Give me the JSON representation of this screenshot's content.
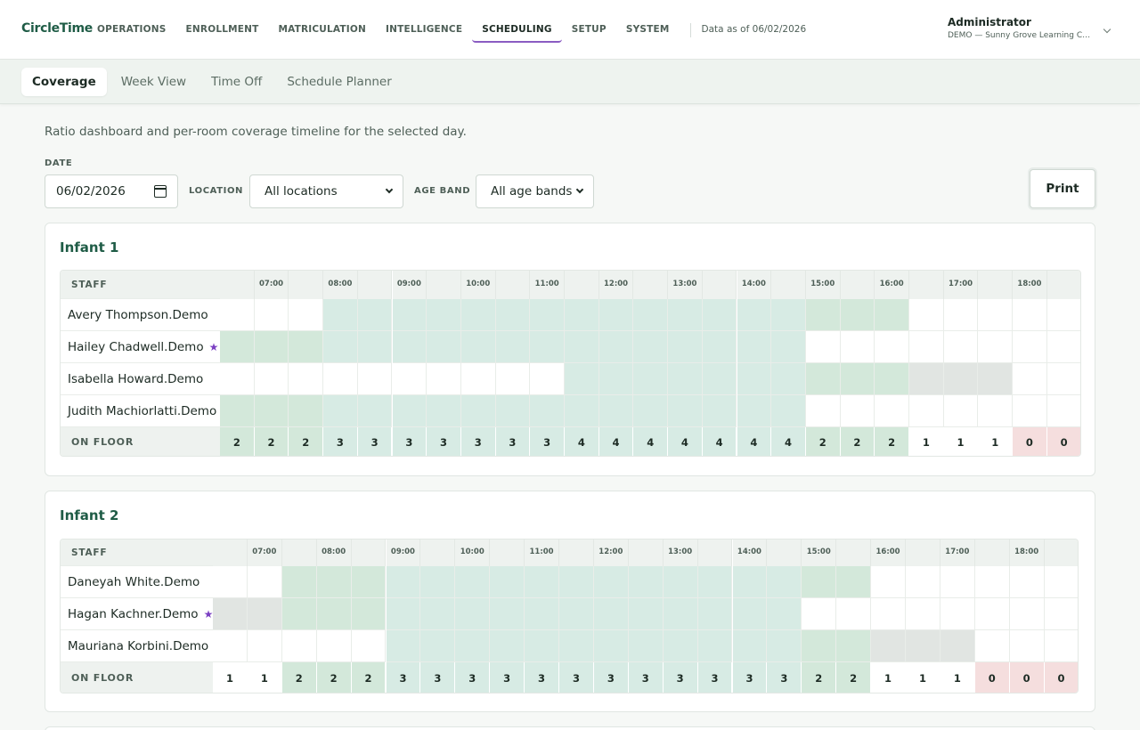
{
  "brand": "CircleTime",
  "nav": {
    "items": [
      "OPERATIONS",
      "ENROLLMENT",
      "MATRICULATION",
      "INTELLIGENCE",
      "SCHEDULING",
      "SETUP",
      "SYSTEM"
    ],
    "active": "SCHEDULING",
    "as_of": "Data as of 06/02/2026"
  },
  "user": {
    "name": "Administrator",
    "org": "DEMO — Sunny Grove Learning Ce..."
  },
  "subtabs": {
    "items": [
      "Coverage",
      "Week View",
      "Time Off",
      "Schedule Planner"
    ],
    "active": "Coverage"
  },
  "description": "Ratio dashboard and per-room coverage timeline for the selected day.",
  "filters": {
    "date_label": "DATE",
    "date_value": "06/02/2026",
    "location_label": "LOCATION",
    "location_value": "All locations",
    "ageband_label": "AGE BAND",
    "ageband_value": "All age bands"
  },
  "print_label": "Print",
  "grid_labels": {
    "staff": "STAFF",
    "on_floor": "ON FLOOR"
  },
  "hour_labels": [
    "",
    "07:00",
    "",
    "08:00",
    "",
    "09:00",
    "",
    "10:00",
    "",
    "11:00",
    "",
    "12:00",
    "",
    "13:00",
    "",
    "14:00",
    "",
    "15:00",
    "",
    "16:00",
    "",
    "17:00",
    "",
    "18:00",
    ""
  ],
  "rooms": [
    {
      "name": "Infant 1",
      "staff": [
        {
          "name": "Avery Thompson.Demo",
          "lead": false,
          "slots": [
            0,
            0,
            0,
            1,
            1,
            1,
            1,
            1,
            1,
            1,
            1,
            1,
            1,
            1,
            1,
            1,
            1,
            2,
            2,
            2,
            0,
            0,
            0,
            0,
            0
          ]
        },
        {
          "name": "Hailey Chadwell.Demo",
          "lead": true,
          "slots": [
            2,
            2,
            2,
            1,
            1,
            1,
            1,
            1,
            1,
            1,
            1,
            1,
            1,
            1,
            1,
            1,
            1,
            0,
            0,
            0,
            0,
            0,
            0,
            0,
            0
          ]
        },
        {
          "name": "Isabella Howard.Demo",
          "lead": false,
          "slots": [
            0,
            0,
            0,
            0,
            0,
            0,
            0,
            0,
            0,
            0,
            1,
            1,
            1,
            1,
            1,
            1,
            1,
            2,
            2,
            2,
            3,
            3,
            3,
            0,
            0
          ]
        },
        {
          "name": "Judith Machiorlatti.Demo",
          "lead": false,
          "slots": [
            2,
            2,
            2,
            1,
            1,
            1,
            1,
            1,
            1,
            1,
            1,
            1,
            1,
            1,
            1,
            1,
            1,
            0,
            0,
            0,
            0,
            0,
            0,
            0,
            0
          ]
        }
      ],
      "on_floor": [
        2,
        2,
        2,
        3,
        3,
        3,
        3,
        3,
        3,
        3,
        4,
        4,
        4,
        4,
        4,
        4,
        4,
        2,
        2,
        2,
        1,
        1,
        1,
        0,
        0
      ]
    },
    {
      "name": "Infant 2",
      "staff": [
        {
          "name": "Daneyah White.Demo",
          "lead": false,
          "slots": [
            0,
            0,
            2,
            2,
            2,
            1,
            1,
            1,
            1,
            1,
            1,
            1,
            1,
            1,
            1,
            1,
            1,
            2,
            2,
            0,
            0,
            0,
            0,
            0,
            0
          ]
        },
        {
          "name": "Hagan Kachner.Demo",
          "lead": true,
          "slots": [
            3,
            3,
            2,
            2,
            2,
            1,
            1,
            1,
            1,
            1,
            1,
            1,
            1,
            1,
            1,
            1,
            1,
            0,
            0,
            0,
            0,
            0,
            0,
            0,
            0
          ]
        },
        {
          "name": "Mauriana Korbini.Demo",
          "lead": false,
          "slots": [
            0,
            0,
            0,
            0,
            0,
            1,
            1,
            1,
            1,
            1,
            1,
            1,
            1,
            1,
            1,
            1,
            1,
            2,
            2,
            3,
            3,
            3,
            0,
            0,
            0
          ]
        }
      ],
      "on_floor": [
        1,
        1,
        2,
        2,
        2,
        3,
        3,
        3,
        3,
        3,
        3,
        3,
        3,
        3,
        3,
        3,
        3,
        2,
        2,
        1,
        1,
        1,
        0,
        0,
        0
      ]
    }
  ],
  "colors": {
    "brand": "#1f5c46",
    "accent": "#8a5cc2",
    "lead_star": "#7a3fc2",
    "coverage_core": "#d7ebe4",
    "coverage_shift": "#d3e8da",
    "break": "#e1e5e2",
    "uncovered": "#f5dede"
  }
}
